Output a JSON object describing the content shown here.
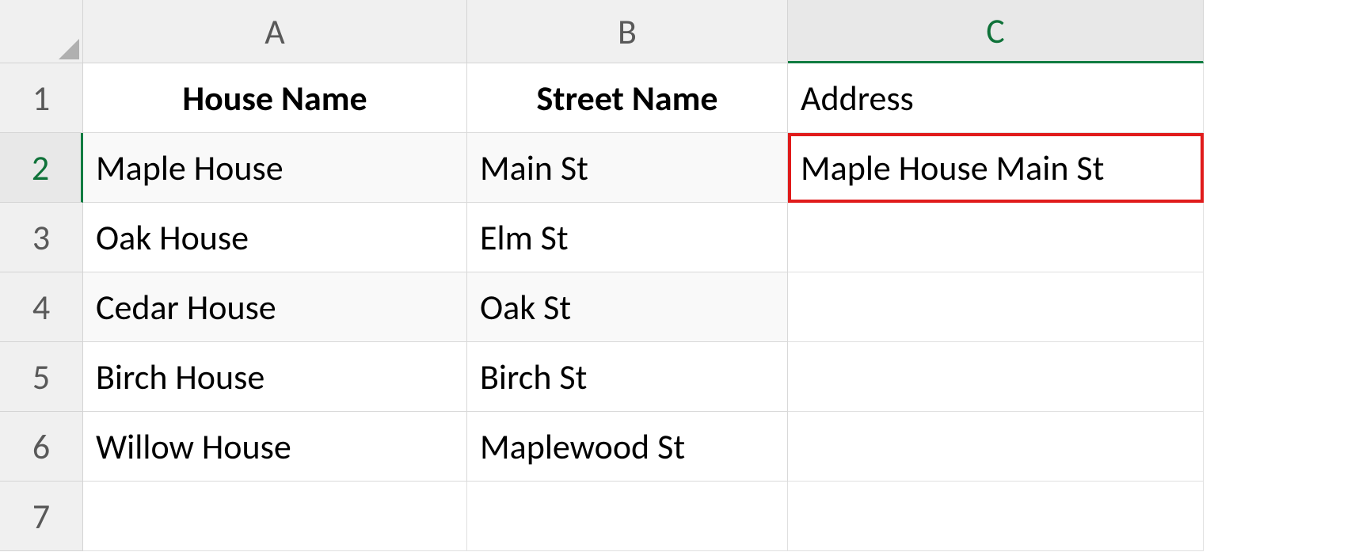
{
  "columns": {
    "A": "A",
    "B": "B",
    "C": "C"
  },
  "rows": {
    "r1": "1",
    "r2": "2",
    "r3": "3",
    "r4": "4",
    "r5": "5",
    "r6": "6",
    "r7": "7"
  },
  "header": {
    "house_name": "House Name",
    "street_name": "Street Name",
    "address": "Address"
  },
  "data": [
    {
      "house": "Maple House",
      "street": "Main St",
      "address": "Maple House Main St"
    },
    {
      "house": "Oak House",
      "street": "Elm St",
      "address": ""
    },
    {
      "house": "Cedar House",
      "street": "Oak St",
      "address": ""
    },
    {
      "house": "Birch House",
      "street": "Birch St",
      "address": ""
    },
    {
      "house": "Willow House",
      "street": "Maplewood St",
      "address": ""
    }
  ],
  "selected_cell": "C2",
  "highlighted_cell": "C2"
}
